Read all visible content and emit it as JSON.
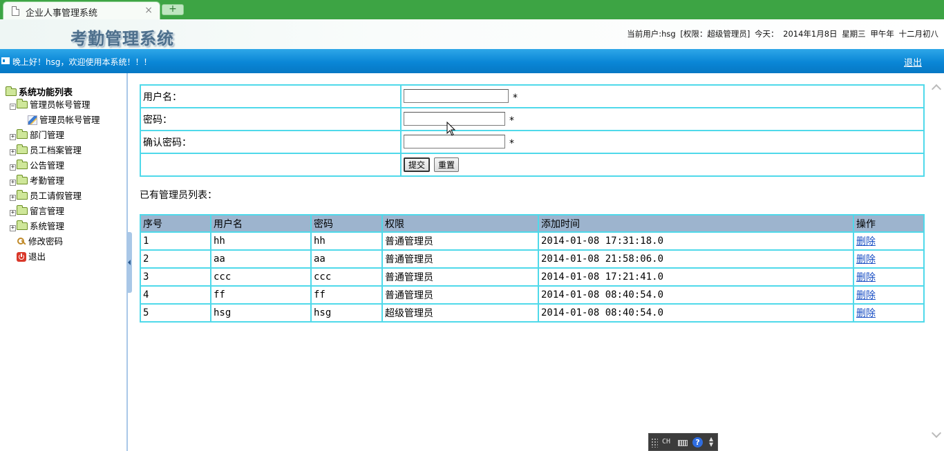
{
  "browser": {
    "tab_title": "企业人事管理系统",
    "close_glyph": "×",
    "new_tab_glyph": "+"
  },
  "header": {
    "system_title": "考勤管理系统",
    "user_info": {
      "current_user": "当前用户:hsg",
      "permission": "[权限：超级管理员]",
      "today_label": "今天：",
      "date": "2014年1月8日",
      "weekday": "星期三",
      "year_ganzhi": "甲午年",
      "lunar_date": "十二月初八"
    }
  },
  "bluebar": {
    "welcome": "晚上好！hsg，欢迎使用本系统！！！",
    "logout": "退出"
  },
  "sidebar": {
    "root_label": "系统功能列表",
    "items": [
      {
        "label": "管理员帐号管理",
        "expanded": true,
        "children": [
          {
            "label": "管理员帐号管理"
          }
        ]
      },
      {
        "label": "部门管理",
        "expanded": false
      },
      {
        "label": "员工档案管理",
        "expanded": false
      },
      {
        "label": "公告管理",
        "expanded": false
      },
      {
        "label": "考勤管理",
        "expanded": false
      },
      {
        "label": "员工请假管理",
        "expanded": false
      },
      {
        "label": "留言管理",
        "expanded": false
      },
      {
        "label": "系统管理",
        "expanded": false
      }
    ],
    "leaves": [
      {
        "label": "修改密码",
        "icon": "key-icon"
      },
      {
        "label": "退出",
        "icon": "exit-icon"
      }
    ],
    "collapse_glyph": "−",
    "expand_glyph": "+"
  },
  "form": {
    "username_label": "用户名：",
    "password_label": "密码：",
    "confirm_label": "确认密码：",
    "username_value": "",
    "password_value": "",
    "confirm_value": "",
    "required_mark": "*",
    "submit_label": "提交",
    "reset_label": "重置"
  },
  "list": {
    "title": "已有管理员列表：",
    "columns": [
      "序号",
      "用户名",
      "密码",
      "权限",
      "添加时间",
      "操作"
    ],
    "rows": [
      {
        "no": "1",
        "username": "hh",
        "password": "hh",
        "role": "普通管理员",
        "added": "2014-01-08 17:31:18.0",
        "action": "删除"
      },
      {
        "no": "2",
        "username": "aa",
        "password": "aa",
        "role": "普通管理员",
        "added": "2014-01-08 21:58:06.0",
        "action": "删除"
      },
      {
        "no": "3",
        "username": "ccc",
        "password": "ccc",
        "role": "普通管理员",
        "added": "2014-01-08 17:21:41.0",
        "action": "删除"
      },
      {
        "no": "4",
        "username": "ff",
        "password": "ff",
        "role": "普通管理员",
        "added": "2014-01-08 08:40:54.0",
        "action": "删除"
      },
      {
        "no": "5",
        "username": "hsg",
        "password": "hsg",
        "role": "超级管理员",
        "added": "2014-01-08 08:40:54.0",
        "action": "删除"
      }
    ]
  },
  "ime": {
    "lang": "CH",
    "help": "?"
  },
  "colors": {
    "tabbar": "#3da444",
    "bluebar": "#0a86d6",
    "table_border": "#4fd9ea",
    "table_header": "#9db4ce",
    "link": "#1a4fc4"
  }
}
